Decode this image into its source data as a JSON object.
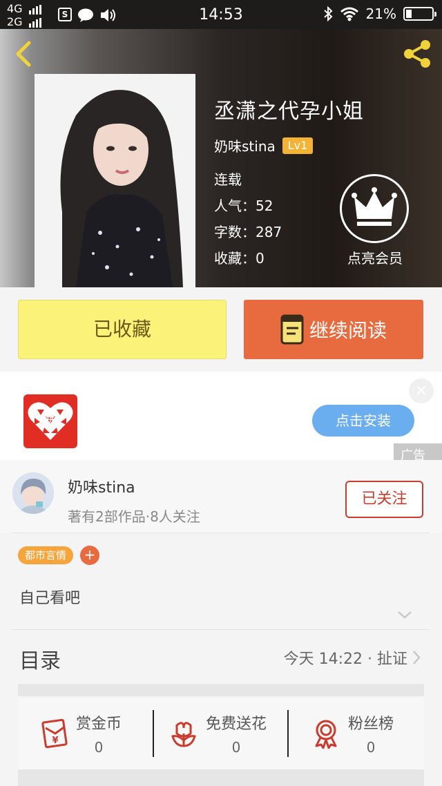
{
  "status_bar": {
    "net1": "4G",
    "net2": "2G",
    "sim_icon_letter": "S",
    "time": "14:53",
    "battery": "21%",
    "battery_level": 0.21
  },
  "header": {
    "book_title": "丞潇之代孕小姐",
    "author": "奶味stina",
    "level": "Lv1",
    "status": "连载",
    "popularity": "人气：52",
    "word_count": "字数：287",
    "collections": "收藏：0",
    "vip_label": "点亮会员"
  },
  "actions": {
    "favorite_label": "已收藏",
    "read_label": "继续阅读"
  },
  "ad": {
    "logo_glyph": "拼",
    "install_label": "点击安装",
    "tag": "广告",
    "close": "×"
  },
  "author_card": {
    "name": "奶味stina",
    "sub": "著有2部作品·8人关注",
    "follow_label": "已关注"
  },
  "tags": {
    "items": [
      "都市言情"
    ],
    "add": "+"
  },
  "intro": "自己看吧",
  "catalog": {
    "title": "目录",
    "latest": "今天 14:22 · 扯证"
  },
  "stats": [
    {
      "label": "赏金币",
      "value": "0",
      "icon": "red-envelope-icon"
    },
    {
      "label": "免费送花",
      "value": "0",
      "icon": "flower-icon"
    },
    {
      "label": "粉丝榜",
      "value": "0",
      "icon": "medal-icon"
    }
  ],
  "colors": {
    "accent_orange": "#e86b3f",
    "favorite_yellow": "#fbf27a",
    "follow_red": "#c93b2c",
    "tag_orange": "#f5a53b",
    "install_blue": "#6aaef0"
  }
}
